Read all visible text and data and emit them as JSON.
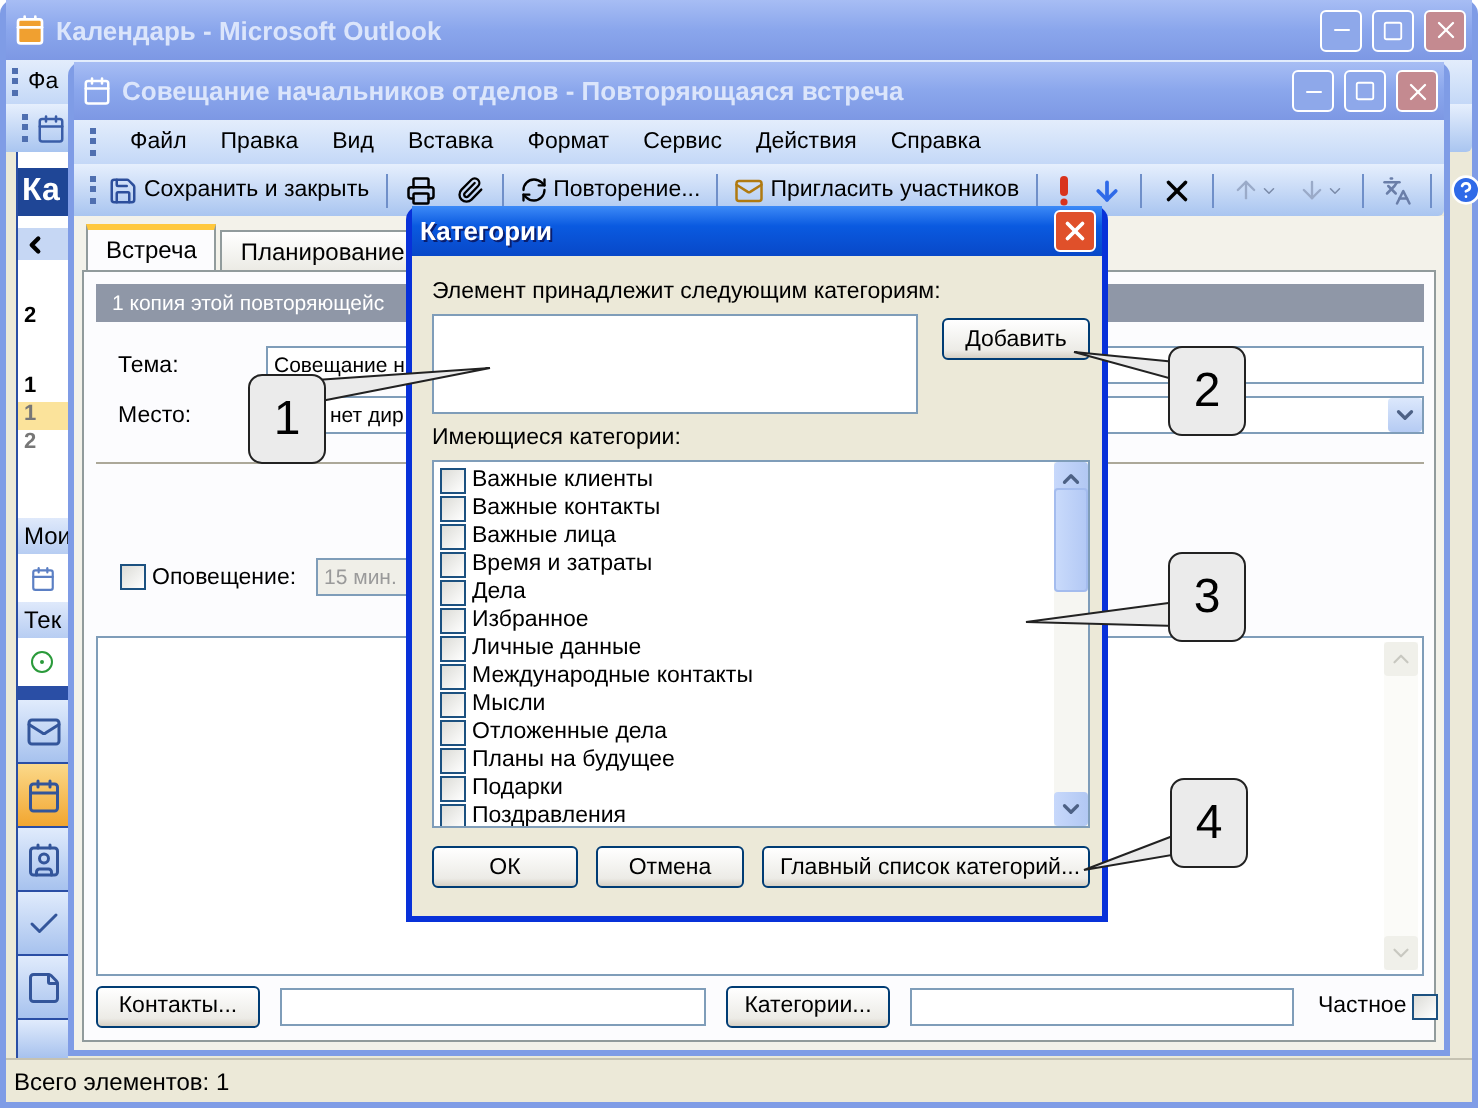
{
  "outer_window": {
    "title": "Календарь - Microsoft Outlook",
    "menu": [
      "Фа"
    ],
    "pane_header": "Ка",
    "mini_calendar": [
      {
        "text": "2",
        "selected": false
      },
      {
        "text": "1",
        "selected": false
      },
      {
        "text": "1",
        "selected": true
      },
      {
        "text": "2",
        "selected": false
      }
    ],
    "sections": [
      "Мои",
      "Тек"
    ],
    "nav_buttons": [
      {
        "selected": false
      },
      {
        "selected": true
      },
      {
        "selected": false
      },
      {
        "selected": false
      },
      {
        "selected": false
      }
    ],
    "status_bar": "Всего элементов: 1"
  },
  "meeting_window": {
    "title": "Совещание начальников отделов - Повторяющаяся встреча",
    "menu": [
      "Файл",
      "Правка",
      "Вид",
      "Вставка",
      "Формат",
      "Сервис",
      "Действия",
      "Справка"
    ],
    "toolbar": {
      "save": "Сохранить и закрыть",
      "recurrence": "Повторение...",
      "invite": "Пригласить участников"
    },
    "tabs": [
      {
        "label": "Встреча",
        "selected": true
      },
      {
        "label": "Планирование",
        "selected": false
      }
    ],
    "info_bar": "1 копия этой повторяющейс",
    "subject": {
      "label": "Тема:",
      "value": "Совещание н"
    },
    "location": {
      "label": "Место:",
      "value": "нет дир"
    },
    "reminder": {
      "label": "Оповещение:",
      "checked": false,
      "value": "15 мин.",
      "disabled": true
    },
    "contacts_button": "Контакты...",
    "categories_button": "Категории...",
    "private": {
      "label": "Частное",
      "checked": false
    }
  },
  "dialog": {
    "title": "Категории",
    "assigned_label": "Элемент принадлежит следующим категориям:",
    "add_button": "Добавить",
    "available_label": "Имеющиеся категории:",
    "categories": [
      {
        "label": "Важные клиенты",
        "checked": false
      },
      {
        "label": "Важные контакты",
        "checked": false
      },
      {
        "label": "Важные лица",
        "checked": false
      },
      {
        "label": "Время и затраты",
        "checked": false
      },
      {
        "label": "Дела",
        "checked": false
      },
      {
        "label": "Избранное",
        "checked": false
      },
      {
        "label": "Личные данные",
        "checked": false
      },
      {
        "label": "Международные контакты",
        "checked": false
      },
      {
        "label": "Мысли",
        "checked": false
      },
      {
        "label": "Отложенные дела",
        "checked": false
      },
      {
        "label": "Планы на будущее",
        "checked": false
      },
      {
        "label": "Подарки",
        "checked": false
      },
      {
        "label": "Поздравления",
        "checked": false
      }
    ],
    "buttons": {
      "ok": "ОК",
      "cancel": "Отмена",
      "master": "Главный список категорий..."
    }
  },
  "callouts": [
    "1",
    "2",
    "3",
    "4"
  ]
}
